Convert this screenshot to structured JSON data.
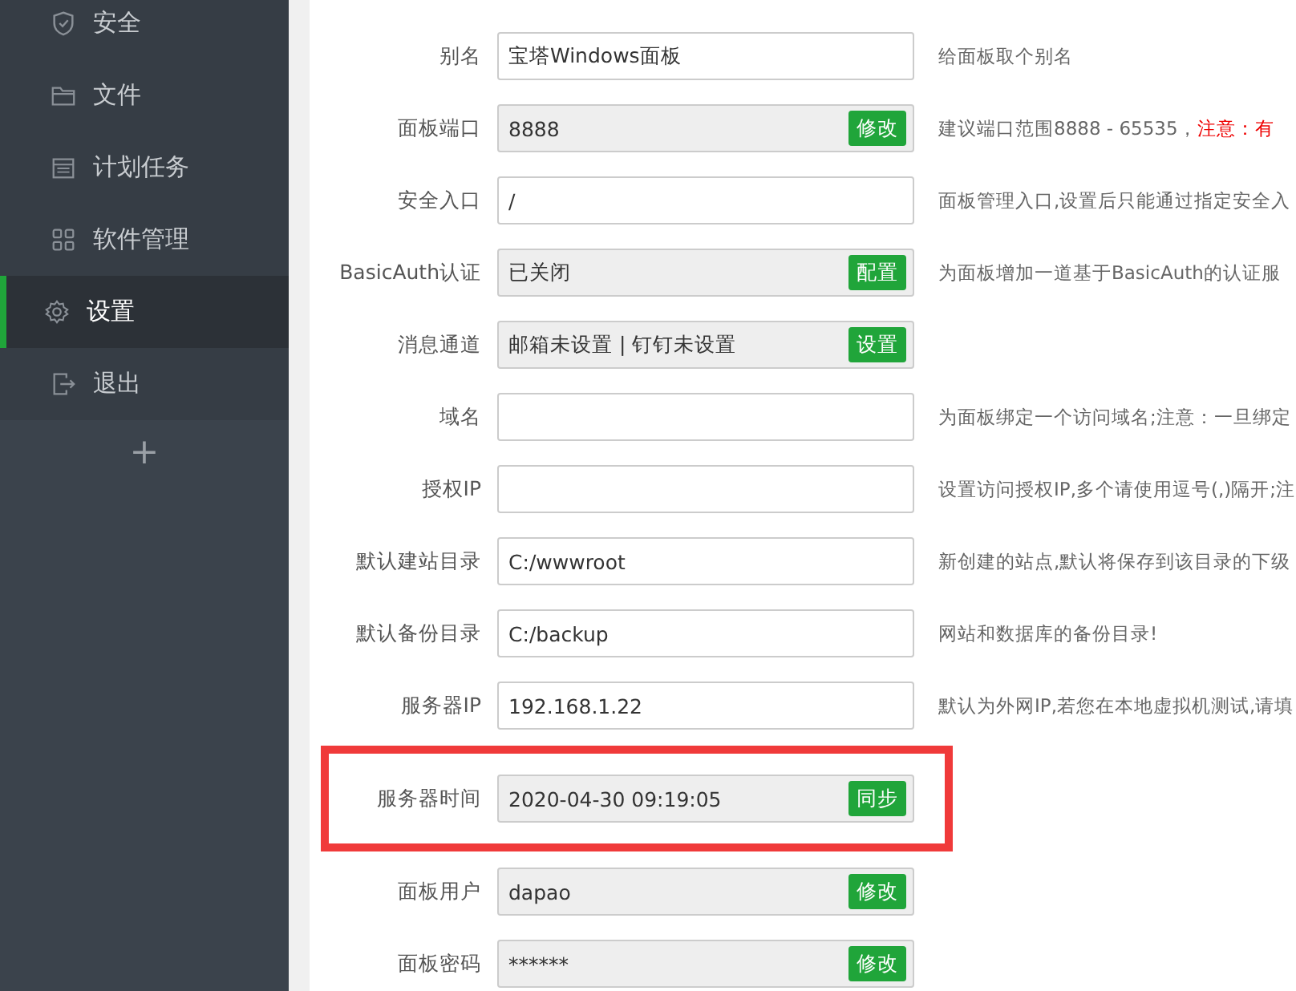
{
  "sidebar": {
    "items": [
      {
        "label": "安全",
        "selected": false
      },
      {
        "label": "文件",
        "selected": false
      },
      {
        "label": "计划任务",
        "selected": false
      },
      {
        "label": "软件管理",
        "selected": false
      },
      {
        "label": "设置",
        "selected": true
      },
      {
        "label": "退出",
        "selected": false
      }
    ],
    "add_button": "+"
  },
  "settings": [
    {
      "label": "别名",
      "kind": "input",
      "value": "宝塔Windows面板",
      "highlighted": false,
      "description": "给面板取个别名"
    },
    {
      "label": "面板端口",
      "kind": "readonly",
      "value": "8888",
      "highlighted": false,
      "buttons": [
        "修改"
      ],
      "description": "建议端口范围8888 - 65535，",
      "warning": "注意：有"
    },
    {
      "label": "安全入口",
      "kind": "input",
      "value": "/",
      "highlighted": false,
      "description": "面板管理入口,设置后只能通过指定安全入"
    },
    {
      "label": "BasicAuth认证",
      "kind": "readonly",
      "value": "已关闭",
      "highlighted": false,
      "buttons": [
        "配置"
      ],
      "description": "为面板增加一道基于BasicAuth的认证服"
    },
    {
      "label": "消息通道",
      "kind": "readonly",
      "value": "邮箱未设置 | 钉钉未设置",
      "highlighted": false,
      "buttons": [
        "设置"
      ]
    },
    {
      "label": "域名",
      "kind": "input",
      "highlighted": false,
      "description": "为面板绑定一个访问域名;注意：一旦绑定"
    },
    {
      "label": "授权IP",
      "kind": "input",
      "highlighted": false,
      "description": "设置访问授权IP,多个请使用逗号(,)隔开;注"
    },
    {
      "label": "默认建站目录",
      "kind": "input",
      "value": "C:/wwwroot",
      "highlighted": false,
      "description": "新创建的站点,默认将保存到该目录的下级"
    },
    {
      "label": "默认备份目录",
      "kind": "input",
      "value": "C:/backup",
      "highlighted": false,
      "description": "网站和数据库的备份目录!"
    },
    {
      "label": "服务器IP",
      "kind": "input",
      "value": "192.168.1.22",
      "highlighted": false,
      "description": "默认为外网IP,若您在本地虚拟机测试,请填"
    },
    {
      "label": "服务器时间",
      "kind": "readonly",
      "value": "2020-04-30 09:19:05",
      "highlighted": true,
      "buttons": [
        "同步"
      ]
    },
    {
      "label": "面板用户",
      "kind": "readonly",
      "value": "dapao",
      "highlighted": false,
      "buttons": [
        "修改"
      ]
    },
    {
      "label": "面板密码",
      "kind": "readonly",
      "value": "******",
      "highlighted": false,
      "buttons": [
        "修改"
      ]
    }
  ]
}
